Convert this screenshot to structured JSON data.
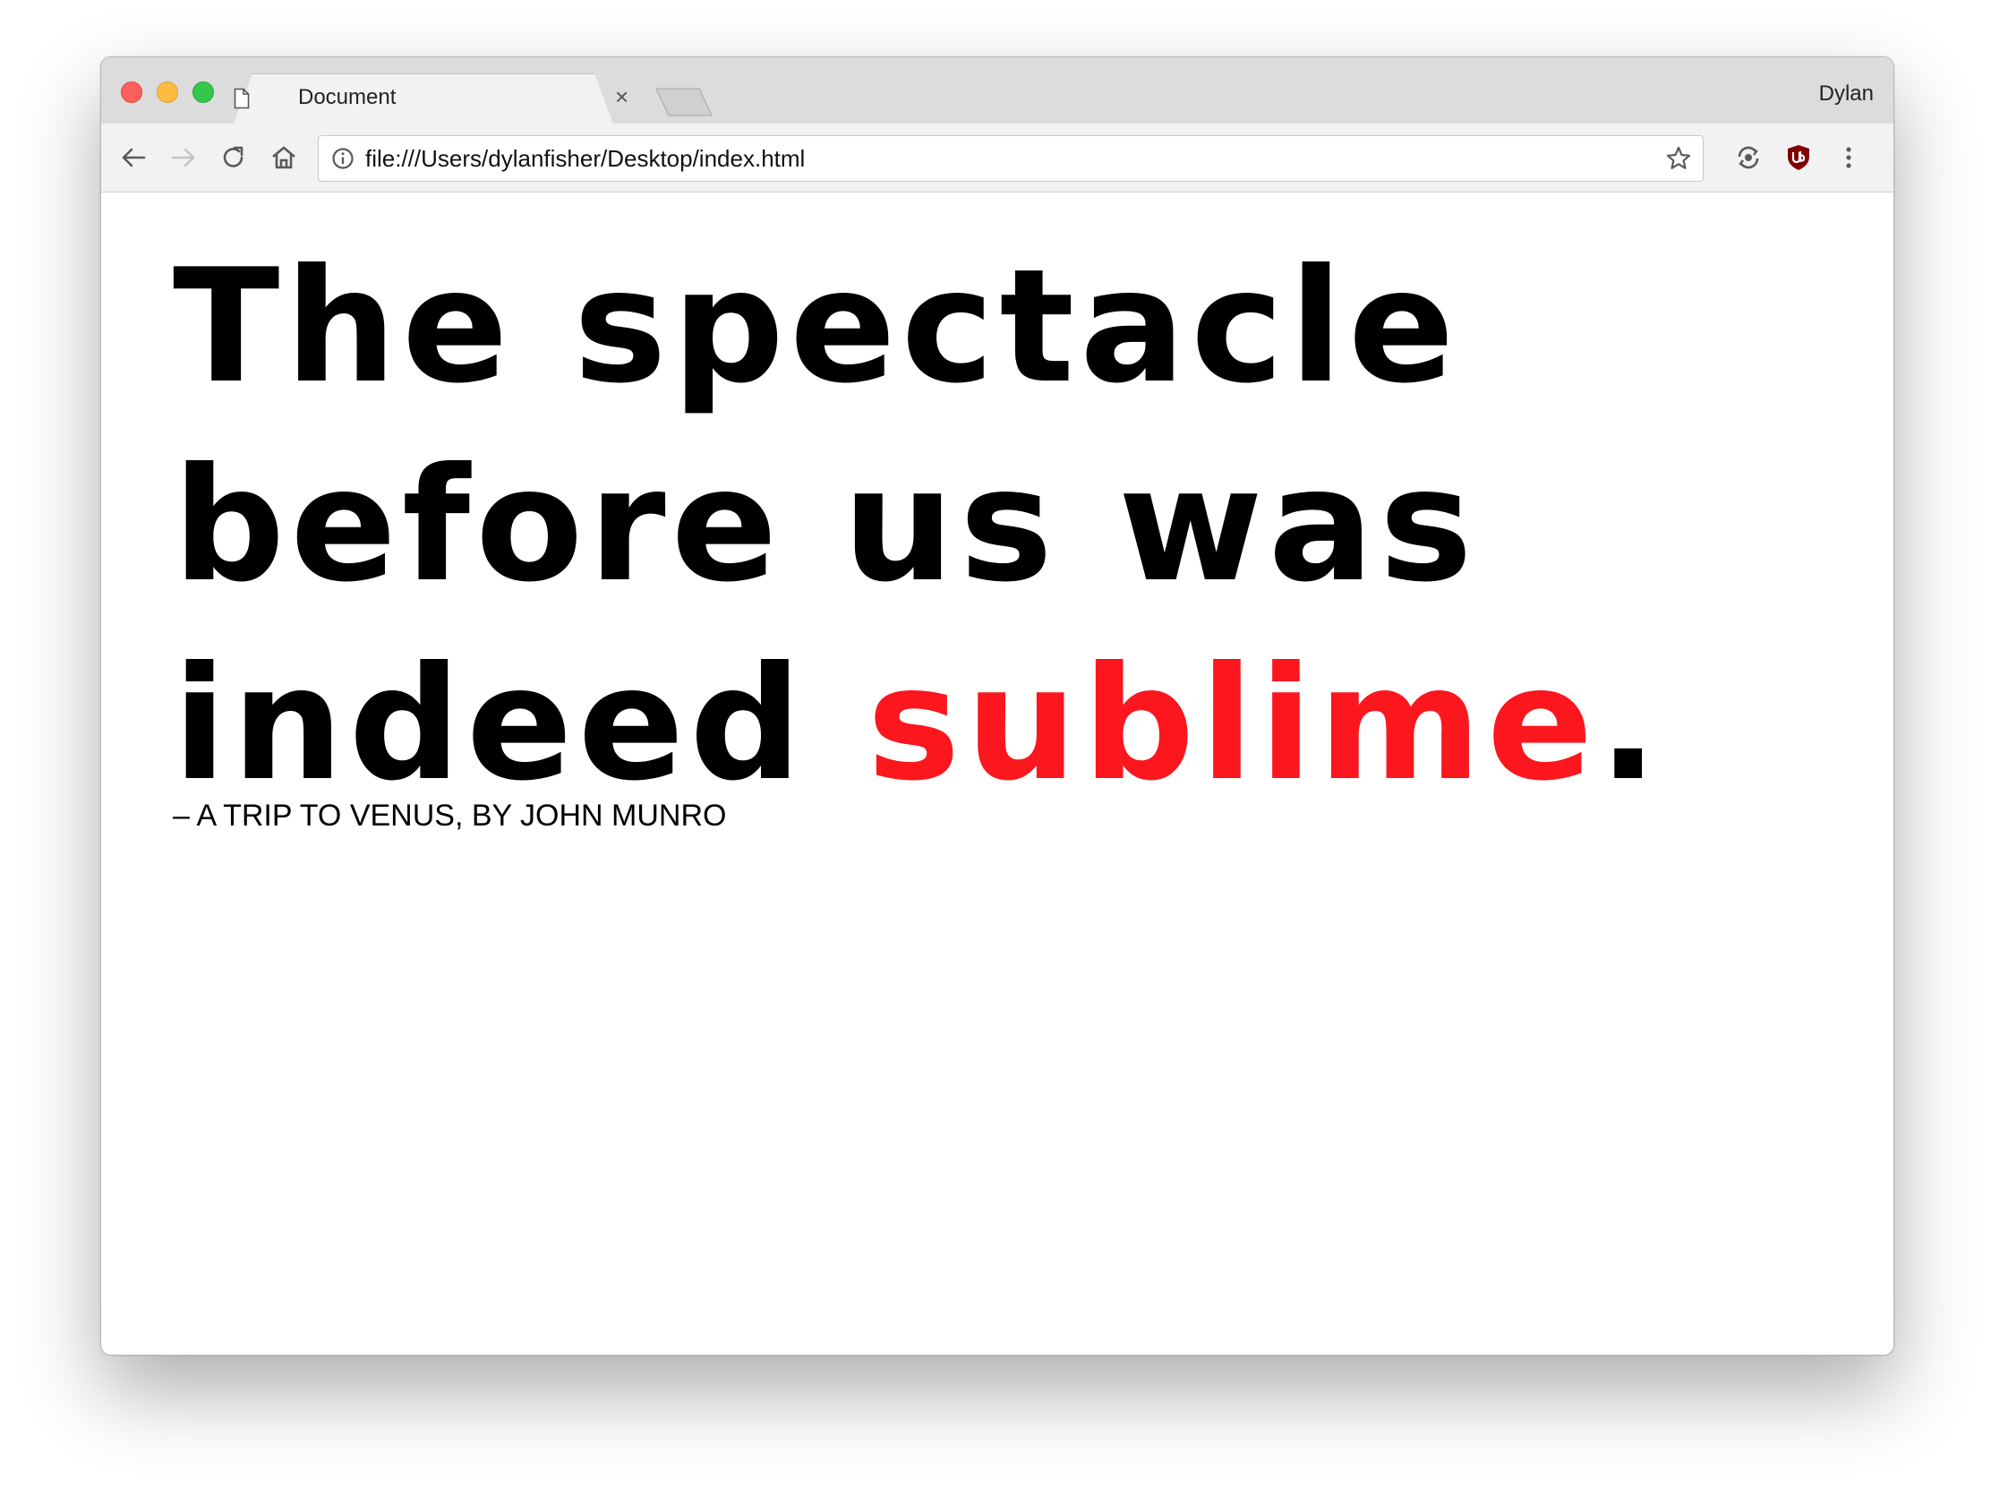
{
  "browser": {
    "tab_title": "Document",
    "tab_close": "×",
    "profile_name": "Dylan",
    "url": "file:///Users/dylanfisher/Desktop/index.html",
    "icons": {
      "back": "arrow-left",
      "forward": "arrow-right",
      "reload": "reload",
      "home": "home",
      "info": "info-circle",
      "star": "star-outline",
      "extension1": "sync-extension",
      "extension2": "ublock-shield",
      "menu": "vertical-ellipsis"
    }
  },
  "page": {
    "quote_part1": "The spectacle before us was indeed ",
    "quote_highlight": "sublime",
    "quote_end": ".",
    "attribution": "– A TRIP TO VENUS, BY JOHN MUNRO",
    "accent_color": "#fc161e"
  }
}
